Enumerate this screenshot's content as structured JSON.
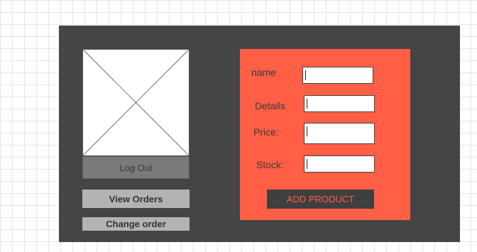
{
  "sidebar": {
    "image_placeholder_icon": "image-placeholder-icon",
    "logout_label": "Log Out",
    "view_orders_label": "View Orders",
    "change_order_label": "Change order"
  },
  "form": {
    "name_label": "name",
    "details_label": "Details",
    "price_label": "Price:",
    "stock_label": "Stock:",
    "name_value": "",
    "details_value": "",
    "price_value": "",
    "stock_value": "",
    "submit_label": "ADD PRODUCT"
  },
  "colors": {
    "panel_bg": "#454545",
    "form_bg": "#ff5f45",
    "submit_text": "#ff5f45"
  }
}
